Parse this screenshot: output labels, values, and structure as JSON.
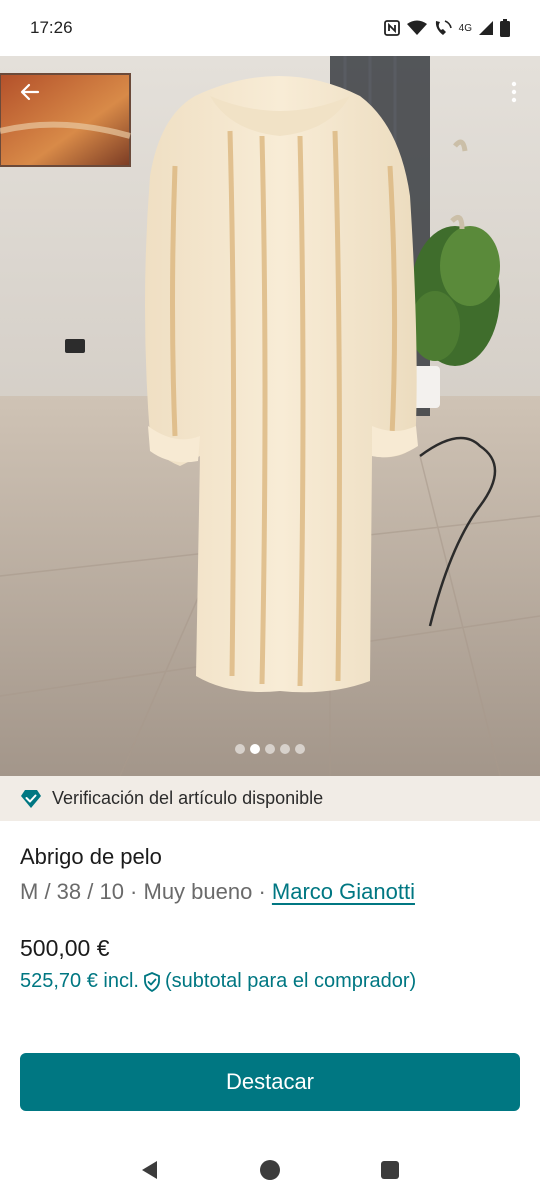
{
  "status_bar": {
    "time": "17:26",
    "network": "4G",
    "icons": [
      "nfc-icon",
      "wifi-icon",
      "volte-call-icon",
      "signal-icon",
      "battery-icon"
    ]
  },
  "gallery": {
    "image_count": 5,
    "active_index": 1,
    "icons": {
      "back": "arrow-left-icon",
      "menu": "more-vert-icon"
    }
  },
  "verification": {
    "text": "Verificación del artículo disponible",
    "icon": "diamond-check-icon",
    "color": "#007782"
  },
  "item": {
    "title": "Abrigo de pelo",
    "size_condition": "M / 38 / 10 · Muy bueno · ",
    "brand": "Marco Gianotti",
    "price": "500,00 €",
    "price_incl": "525,70 €  incl.",
    "price_incl_note": "(subtotal para el comprador)",
    "protection_icon": "shield-check-icon"
  },
  "cta": {
    "label": "Destacar",
    "color": "#007782"
  },
  "navigation": {
    "icons": [
      "back-triangle-icon",
      "home-circle-icon",
      "recents-square-icon"
    ]
  }
}
